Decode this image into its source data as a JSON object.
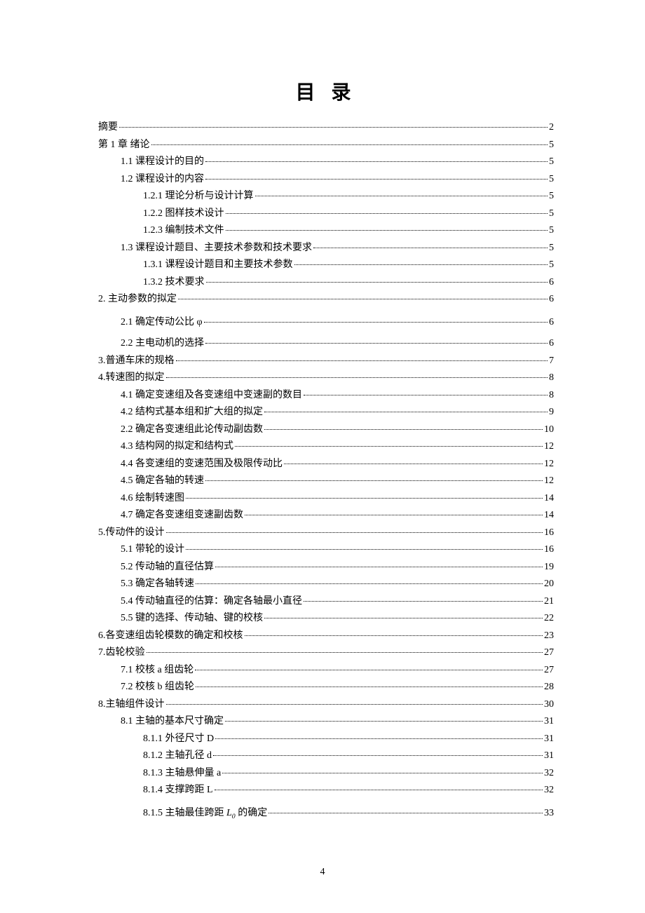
{
  "title": "目 录",
  "footer_page": "4",
  "toc": [
    {
      "level": 0,
      "label": "摘要",
      "page": "2"
    },
    {
      "level": 0,
      "label": "第 1 章  绪论",
      "page": "5"
    },
    {
      "level": 1,
      "label": "1.1  课程设计的目的",
      "page": "5"
    },
    {
      "level": 1,
      "label": "1.2 课程设计的内容",
      "page": "5"
    },
    {
      "level": 2,
      "label": "1.2.1  理论分析与设计计算",
      "page": "5"
    },
    {
      "level": 2,
      "label": "1.2.2  图样技术设计",
      "page": "5"
    },
    {
      "level": 2,
      "label": "1.2.3 编制技术文件",
      "page": "5"
    },
    {
      "level": 1,
      "label": "1.3 课程设计题目、主要技术参数和技术要求",
      "page": "5"
    },
    {
      "level": 2,
      "label": "1.3.1 课程设计题目和主要技术参数",
      "page": "5"
    },
    {
      "level": 2,
      "label": "1.3.2 技术要求",
      "page": "6"
    },
    {
      "level": 0,
      "label": "2.    主动参数的拟定",
      "page": "6"
    },
    {
      "level": 1,
      "label": "2.1 确定传动公比 φ ",
      "page": "6",
      "tall": true
    },
    {
      "level": 1,
      "label": "2.2 主电动机的选择",
      "page": "6"
    },
    {
      "level": 0,
      "label": "3.普通车床的规格",
      "page": "7"
    },
    {
      "level": 0,
      "label": "4.转速图的拟定",
      "page": "8"
    },
    {
      "level": 1,
      "label": "4.1 确定变速组及各变速组中变速副的数目",
      "page": "8"
    },
    {
      "level": 1,
      "label": "4.2 结构式基本组和扩大组的拟定",
      "page": "9"
    },
    {
      "level": 1,
      "label": "2.2  确定各变速组此论传动副齿数",
      "page": "10"
    },
    {
      "level": 1,
      "label": "4.3 结构网的拟定和结构式",
      "page": "12"
    },
    {
      "level": 1,
      "label": "4.4 各变速组的变速范围及极限传动比",
      "page": "12"
    },
    {
      "level": 1,
      "label": "4.5 确定各轴的转速",
      "page": "12"
    },
    {
      "level": 1,
      "label": "4.6 绘制转速图",
      "page": "14"
    },
    {
      "level": 1,
      "label": "4.7 确定各变速组变速副齿数",
      "page": "14"
    },
    {
      "level": 0,
      "label": "5.传动件的设计",
      "page": "16"
    },
    {
      "level": 1,
      "label": "5.1 带轮的设计",
      "page": "16"
    },
    {
      "level": 1,
      "label": "5.2 传动轴的直径估算",
      "page": "19"
    },
    {
      "level": 1,
      "label": "5.3 确定各轴转速",
      "page": "20"
    },
    {
      "level": 1,
      "label": "5.4 传动轴直径的估算：确定各轴最小直径",
      "page": "21"
    },
    {
      "level": 1,
      "label": "5.5 键的选择、传动轴、键的校核",
      "page": "22"
    },
    {
      "level": 0,
      "label": "6.各变速组齿轮模数的确定和校核",
      "page": "23"
    },
    {
      "level": 0,
      "label": "7.齿轮校验",
      "page": "27"
    },
    {
      "level": 1,
      "label": "7.1 校核 a 组齿轮",
      "page": "27"
    },
    {
      "level": 1,
      "label": "7.2  校核 b 组齿轮",
      "page": "28"
    },
    {
      "level": 0,
      "label": "8.主轴组件设计",
      "page": "30"
    },
    {
      "level": 1,
      "label": "8.1 主轴的基本尺寸确定",
      "page": "31"
    },
    {
      "level": 2,
      "label": "8.1.1 外径尺寸 D",
      "page": "31"
    },
    {
      "level": 2,
      "label": "8.1.2 主轴孔径 d",
      "page": "31"
    },
    {
      "level": 2,
      "label": "8.1.3 主轴悬伸量 a",
      "page": "32"
    },
    {
      "level": 2,
      "label": "8.1.4 支撑跨距 L",
      "page": "32"
    },
    {
      "level": 2,
      "label_html": "8.1.5 主轴最佳跨距 <span class='math'>L<sub>0</sub></span> 的确定 ",
      "label": "8.1.5 主轴最佳跨距 L0 的确定 ",
      "page": "33",
      "tall": true
    }
  ]
}
